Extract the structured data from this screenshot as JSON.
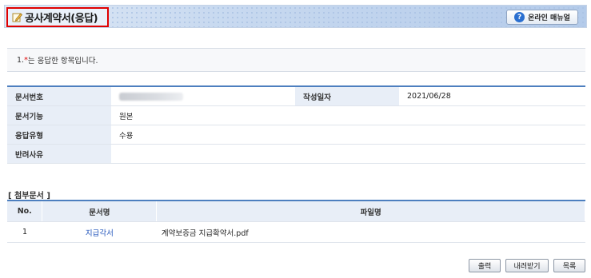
{
  "header": {
    "title": "공사계약서(응답)",
    "manual_button": "온라인 매뉴얼",
    "manual_icon": "question-icon"
  },
  "notice": {
    "prefix": "1. ",
    "star": "*",
    "text": "는 응답한 항목입니다."
  },
  "info": {
    "doc_no_label": "문서번호",
    "doc_no_value": "",
    "date_label": "작성일자",
    "date_value": "2021/06/28",
    "function_label": "문서기능",
    "function_value": "원본",
    "response_label": "응답유형",
    "response_value": "수용",
    "reject_label": "반려사유",
    "reject_value": ""
  },
  "attachments": {
    "title": "[ 첨부문서 ]",
    "columns": [
      "No.",
      "문서명",
      "파일명"
    ],
    "rows": [
      {
        "no": "1",
        "doc_name": "지급각서",
        "file_name": "계약보증금 지급확약서.pdf"
      }
    ]
  },
  "buttons": {
    "print": "출력",
    "download": "내려받기",
    "list": "목록"
  },
  "colors": {
    "accent": "#4d7fbf",
    "required_star": "#e00000",
    "link": "#2255bb",
    "highlight_border": "#e00000"
  }
}
